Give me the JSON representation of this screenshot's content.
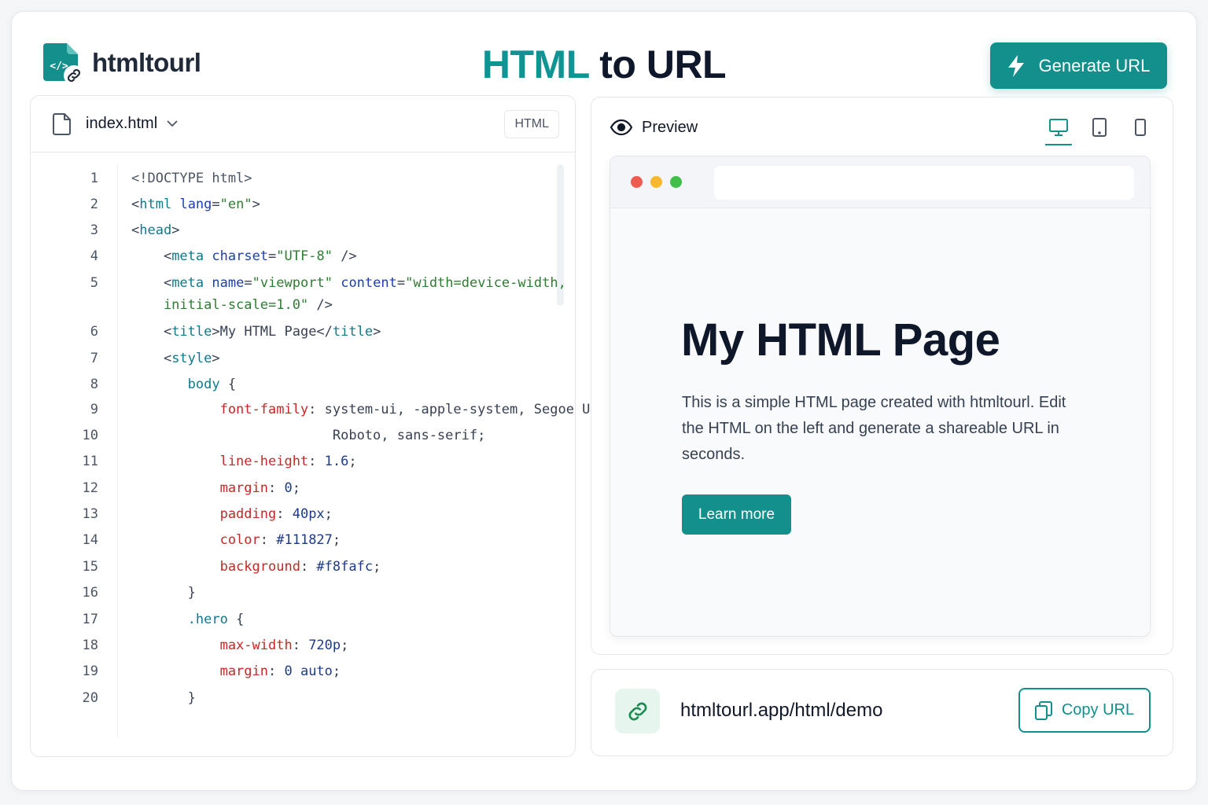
{
  "header": {
    "logo_text": "htmltourl",
    "title_accent": "HTML",
    "title_rest": " to URL",
    "generate_label": "Generate URL"
  },
  "editor": {
    "file_name": "index.html",
    "language_badge": "HTML",
    "lines": [
      {
        "n": "1",
        "parts": [
          [
            "doc",
            "<!DOCTYPE html>"
          ]
        ]
      },
      {
        "n": "2",
        "parts": [
          [
            "pun",
            "<"
          ],
          [
            "tag",
            "html"
          ],
          [
            "pun",
            " "
          ],
          [
            "attr",
            "lang"
          ],
          [
            "pun",
            "="
          ],
          [
            "str",
            "\"en\""
          ],
          [
            "pun",
            ">"
          ]
        ]
      },
      {
        "n": "3",
        "parts": [
          [
            "pun",
            "<"
          ],
          [
            "tag",
            "head"
          ],
          [
            "pun",
            ">"
          ]
        ]
      },
      {
        "n": "4",
        "parts": [
          [
            "pun",
            "    <"
          ],
          [
            "tag",
            "meta"
          ],
          [
            "pun",
            " "
          ],
          [
            "attr",
            "charset"
          ],
          [
            "pun",
            "="
          ],
          [
            "str",
            "\"UTF-8\""
          ],
          [
            "pun",
            " />"
          ]
        ]
      },
      {
        "n": "5",
        "parts": [
          [
            "pun",
            "    <"
          ],
          [
            "tag",
            "meta"
          ],
          [
            "pun",
            " "
          ],
          [
            "attr",
            "name"
          ],
          [
            "pun",
            "="
          ],
          [
            "str",
            "\"viewport\""
          ],
          [
            "pun",
            " "
          ],
          [
            "attr",
            "content"
          ],
          [
            "pun",
            "="
          ],
          [
            "str",
            "\"width=device-width,"
          ]
        ]
      },
      {
        "n": "",
        "parts": [
          [
            "str",
            "    initial-scale=1.0\""
          ],
          [
            "pun",
            " />"
          ]
        ]
      },
      {
        "n": "6",
        "parts": [
          [
            "pun",
            "    <"
          ],
          [
            "tag",
            "title"
          ],
          [
            "pun",
            ">My HTML Page</"
          ],
          [
            "tag",
            "title"
          ],
          [
            "pun",
            ">"
          ]
        ]
      },
      {
        "n": "7",
        "parts": [
          [
            "pun",
            "    <"
          ],
          [
            "tag",
            "style"
          ],
          [
            "pun",
            ">"
          ]
        ]
      },
      {
        "n": "8",
        "parts": [
          [
            "sel",
            "       body"
          ],
          [
            "pun",
            " {"
          ]
        ]
      },
      {
        "n": "9",
        "parts": [
          [
            "prop",
            "           font-family"
          ],
          [
            "pun",
            ": system-ui, -apple-system, Segoe UI,"
          ]
        ]
      },
      {
        "n": "10",
        "parts": [
          [
            "pun",
            "                         Roboto, sans-serif;"
          ]
        ]
      },
      {
        "n": "11",
        "parts": [
          [
            "prop",
            "           line-height"
          ],
          [
            "pun",
            ": "
          ],
          [
            "val",
            "1.6"
          ],
          [
            "pun",
            ";"
          ]
        ]
      },
      {
        "n": "12",
        "parts": [
          [
            "prop",
            "           margin"
          ],
          [
            "pun",
            ": "
          ],
          [
            "val",
            "0"
          ],
          [
            "pun",
            ";"
          ]
        ]
      },
      {
        "n": "13",
        "parts": [
          [
            "prop",
            "           padding"
          ],
          [
            "pun",
            ": "
          ],
          [
            "val",
            "40px"
          ],
          [
            "pun",
            ";"
          ]
        ]
      },
      {
        "n": "14",
        "parts": [
          [
            "prop",
            "           color"
          ],
          [
            "pun",
            ": "
          ],
          [
            "val",
            "#111827"
          ],
          [
            "pun",
            ";"
          ]
        ]
      },
      {
        "n": "15",
        "parts": [
          [
            "prop",
            "           background"
          ],
          [
            "pun",
            ": "
          ],
          [
            "val",
            "#f8fafc"
          ],
          [
            "pun",
            ";"
          ]
        ]
      },
      {
        "n": "16",
        "parts": [
          [
            "pun",
            "       }"
          ]
        ]
      },
      {
        "n": "17",
        "parts": [
          [
            "sel",
            "       .hero"
          ],
          [
            "pun",
            " {"
          ]
        ]
      },
      {
        "n": "18",
        "parts": [
          [
            "prop",
            "           max-width"
          ],
          [
            "pun",
            ": "
          ],
          [
            "val",
            "720p"
          ],
          [
            "pun",
            ";"
          ]
        ]
      },
      {
        "n": "19",
        "parts": [
          [
            "prop",
            "           margin"
          ],
          [
            "pun",
            ": "
          ],
          [
            "val",
            "0 auto"
          ],
          [
            "pun",
            ";"
          ]
        ]
      },
      {
        "n": "20",
        "parts": [
          [
            "pun",
            "       }"
          ]
        ]
      }
    ]
  },
  "preview": {
    "label": "Preview",
    "devices": [
      "desktop-icon",
      "tablet-icon",
      "mobile-icon"
    ],
    "active_device": "desktop",
    "page_title": "My HTML Page",
    "page_body": "This is a simple HTML page created with htmltourl. Edit the HTML on the left and generate a shareable URL in seconds.",
    "page_button": "Learn more"
  },
  "share": {
    "url": "htmltourl.app/html/demo",
    "copy_label": "Copy URL"
  },
  "colors": {
    "accent": "#138f8c",
    "title_accent": "#0f9494",
    "dot_red": "#ef5a4f",
    "dot_yellow": "#f5b82e",
    "dot_green": "#3fbf4a"
  }
}
